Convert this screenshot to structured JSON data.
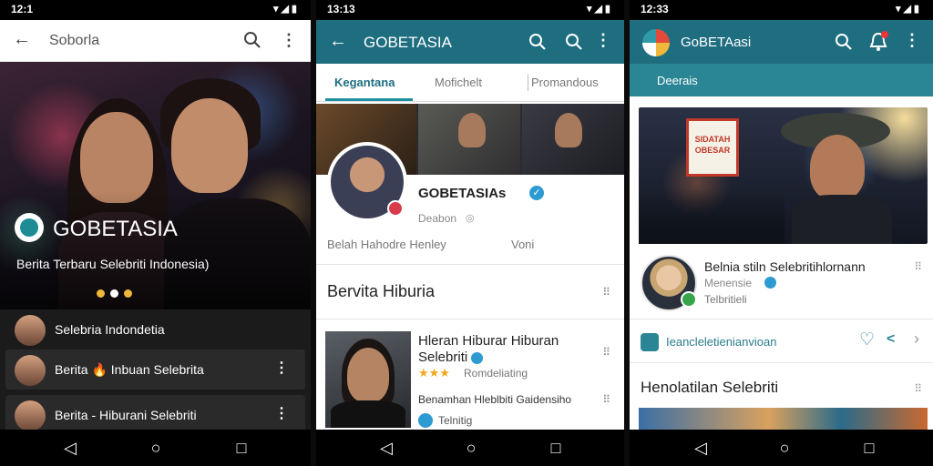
{
  "phone1": {
    "status_time": "12:1",
    "status_icons": "▾◢▮",
    "appbar": {
      "title": "Soborla"
    },
    "hero": {
      "brand": "GOBETASIA",
      "tagline": "Berita Terbaru Selebriti Indonesia)"
    },
    "list": [
      {
        "label": "Selebria Indondetia"
      },
      {
        "label": "Berita 🔥 Inbuan Selebrita"
      },
      {
        "label": "Berita - Hiburani Selebriti"
      }
    ]
  },
  "phone2": {
    "status_time": "13:13",
    "status_icons": "▾◢▮",
    "appbar": {
      "title": "GOBETASIA"
    },
    "tabs": [
      "Kegantana",
      "Mofichelt",
      "Promandous"
    ],
    "profile": {
      "name": "GOBETASIAs",
      "sub": "Deabon",
      "meta_left": "Belah Hahodre Henley",
      "meta_right": "Voni"
    },
    "section_title": "Bervita Hiburia",
    "article": {
      "title": "Hleran Hiburar Hiburan Selebriti",
      "rating_label": "Romdeliating",
      "line1": "Benamhan Hleblbiti Gaidensiho",
      "line2": "Telnitig"
    }
  },
  "phone3": {
    "status_time": "12:33",
    "status_icons": "▾◢▮",
    "appbar": {
      "title": "GoBETAasi"
    },
    "subtab": "Deerais",
    "hero_sign": "SIDATAH OBESAR",
    "celeb": {
      "name": "Belnia stiln Selebritihlornann",
      "sub": "Menensie",
      "tag": "Telbritieli"
    },
    "link_label": "Ieancleletienianvioan",
    "section_title": "Henolatilan Selebriti"
  },
  "icons": {
    "back": "←",
    "more": "⋮",
    "nav_back": "◁",
    "nav_home": "○",
    "nav_recent": "□",
    "grid": "⠿",
    "heart": "♡",
    "share": "<",
    "chevron": "›",
    "stars": "★★★"
  },
  "colors": {
    "teal_appbar": "#1f6e80",
    "teal_accent": "#2a8595",
    "verified_blue": "#2d9bd2",
    "dot_gold": "#f0b73a"
  }
}
